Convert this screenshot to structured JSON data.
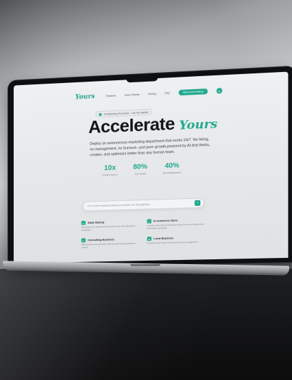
{
  "site": {
    "logo": "Yours",
    "nav": {
      "links": [
        "Features",
        "How it Works",
        "Pricing",
        "FAQ"
      ],
      "cta": "Start Accelerating",
      "cta_icon": "arrow-right-icon"
    },
    "badge": "AI Marketing Revolution · Join the Waitlist",
    "hero": {
      "title": "Accelerate",
      "script": "Yours",
      "subtitle": "Deploy an autonomous marketing department that works 24/7. No hiring, no management, no burnout—just pure growth powered by AI that thinks, creates, and optimizes better than any human team."
    },
    "stats": [
      {
        "value": "10x",
        "label": "Content Volume"
      },
      {
        "value": "80%",
        "label": "Time Saved"
      },
      {
        "value": "40%",
        "label": "More Engagement"
      }
    ],
    "search": {
      "placeholder": "I'm a SaaS startup looking to increase our trial signups...",
      "button_icon": "send-icon"
    },
    "cards": [
      {
        "title": "SaaS Startup",
        "desc": "Accelerate user acquisition and reduce churn with data-driven campaigns"
      },
      {
        "title": "E-commerce Store",
        "desc": "Increase sales with personalized product recommendations and automated campaigns"
      },
      {
        "title": "Consulting Business",
        "desc": "Build authority and generate leads through thought leadership content"
      },
      {
        "title": "Local Business",
        "desc": "Dominate local search and build community engagement"
      }
    ]
  },
  "colors": {
    "accent": "#22a98e",
    "heading": "#121416"
  }
}
